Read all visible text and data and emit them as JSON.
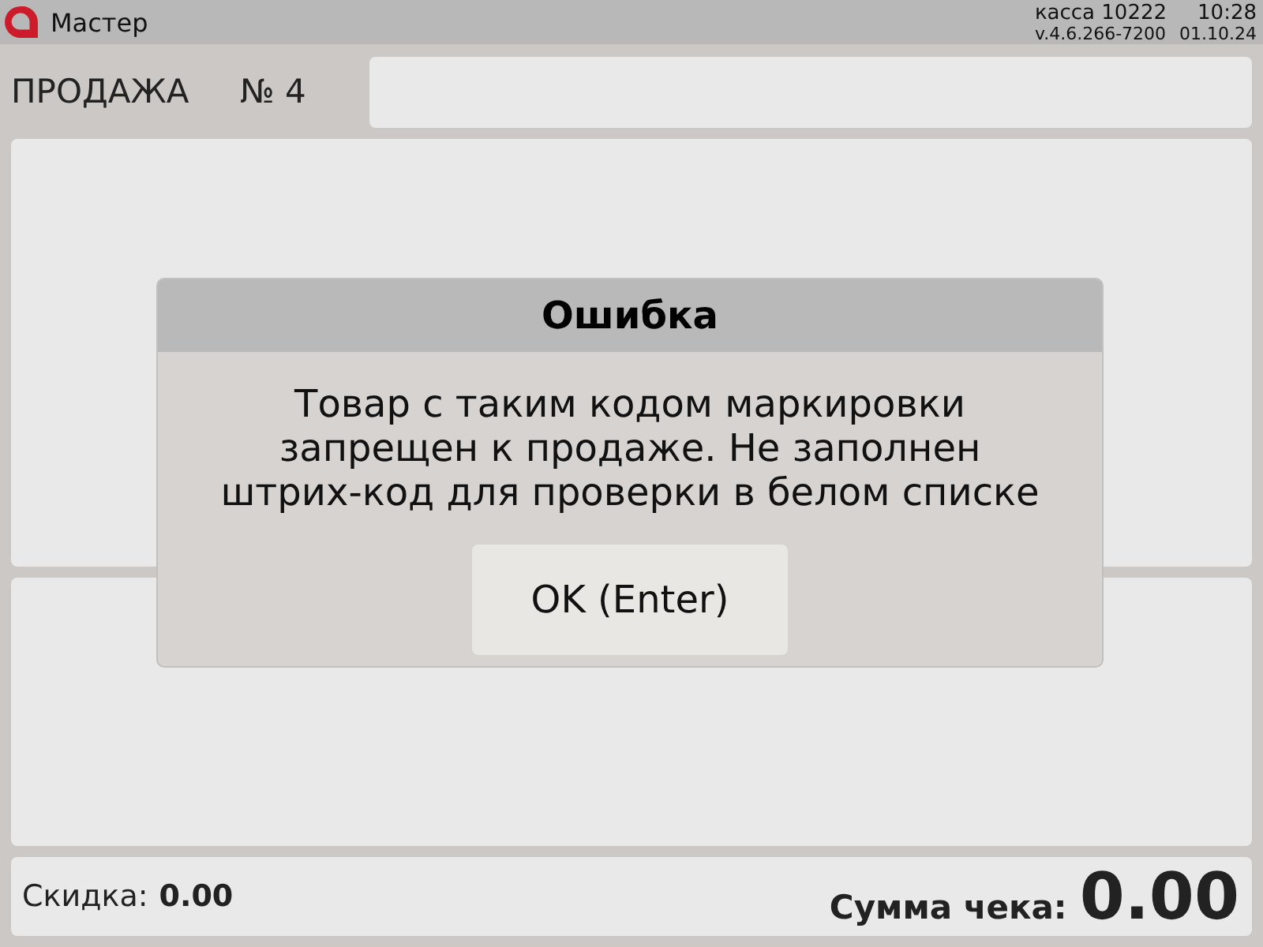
{
  "header": {
    "app_name": "Мастер",
    "register": "касса 10222",
    "time": "10:28",
    "version": "v.4.6.266-7200",
    "date": "01.10.24"
  },
  "sale": {
    "title": "ПРОДАЖА",
    "number": "№ 4"
  },
  "footer": {
    "discount_label": "Скидка:",
    "discount_value": "0.00",
    "total_label": "Сумма чека:",
    "total_value": "0.00"
  },
  "dialog": {
    "title": "Ошибка",
    "message": "Товар с таким кодом маркировки запрещен к продаже. Не заполнен штрих-код для проверки в белом списке",
    "button": "OK (Enter)"
  }
}
